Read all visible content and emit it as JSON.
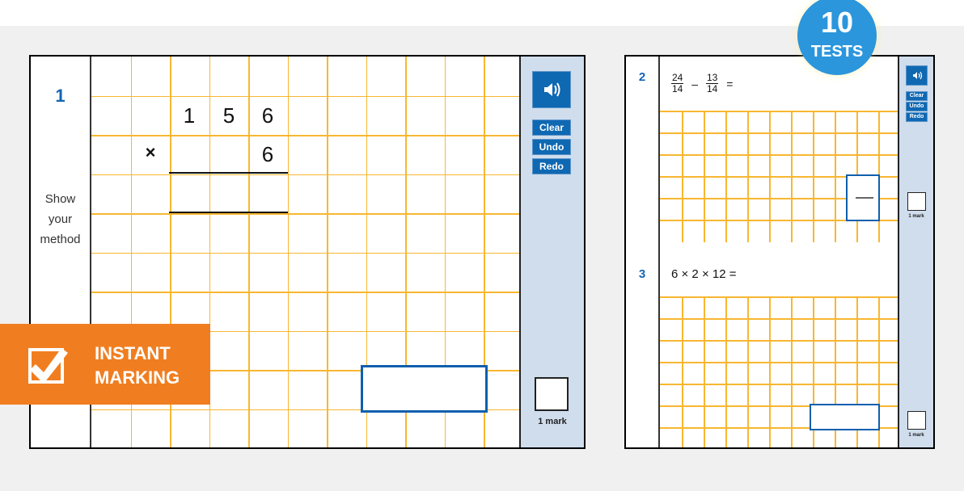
{
  "colors": {
    "accent_blue": "#1565b0",
    "button_blue": "#0f68b2",
    "grid_orange": "#f8b731",
    "sidebar_bg": "#cfdded",
    "badge_orange": "#f07e20",
    "tests_blue": "#2b96dc"
  },
  "badge": {
    "icon": "checkbox-check-icon",
    "line1": "INSTANT",
    "line2": "MARKING"
  },
  "tests_badge": {
    "count": "10",
    "label": "TESTS"
  },
  "question1": {
    "number": "1",
    "method_lines": [
      "Show",
      "your",
      "method"
    ],
    "top_digits": [
      "1",
      "5",
      "6"
    ],
    "operator": "×",
    "multiplier": "6",
    "tools": {
      "speaker_icon": "speaker-icon",
      "clear": "Clear",
      "undo": "Undo",
      "redo": "Redo"
    },
    "mark_label": "1 mark"
  },
  "question2": {
    "number": "2",
    "fraction_a": {
      "num": "24",
      "den": "14"
    },
    "operator": "–",
    "fraction_b": {
      "num": "13",
      "den": "14"
    },
    "equals": "=",
    "answer_separator": "—",
    "tools": {
      "speaker_icon": "speaker-icon",
      "clear": "Clear",
      "undo": "Undo",
      "redo": "Redo"
    },
    "mark_label": "1 mark"
  },
  "question3": {
    "number": "3",
    "expression": "6 × 2 × 12 =",
    "mark_label": "1 mark"
  }
}
